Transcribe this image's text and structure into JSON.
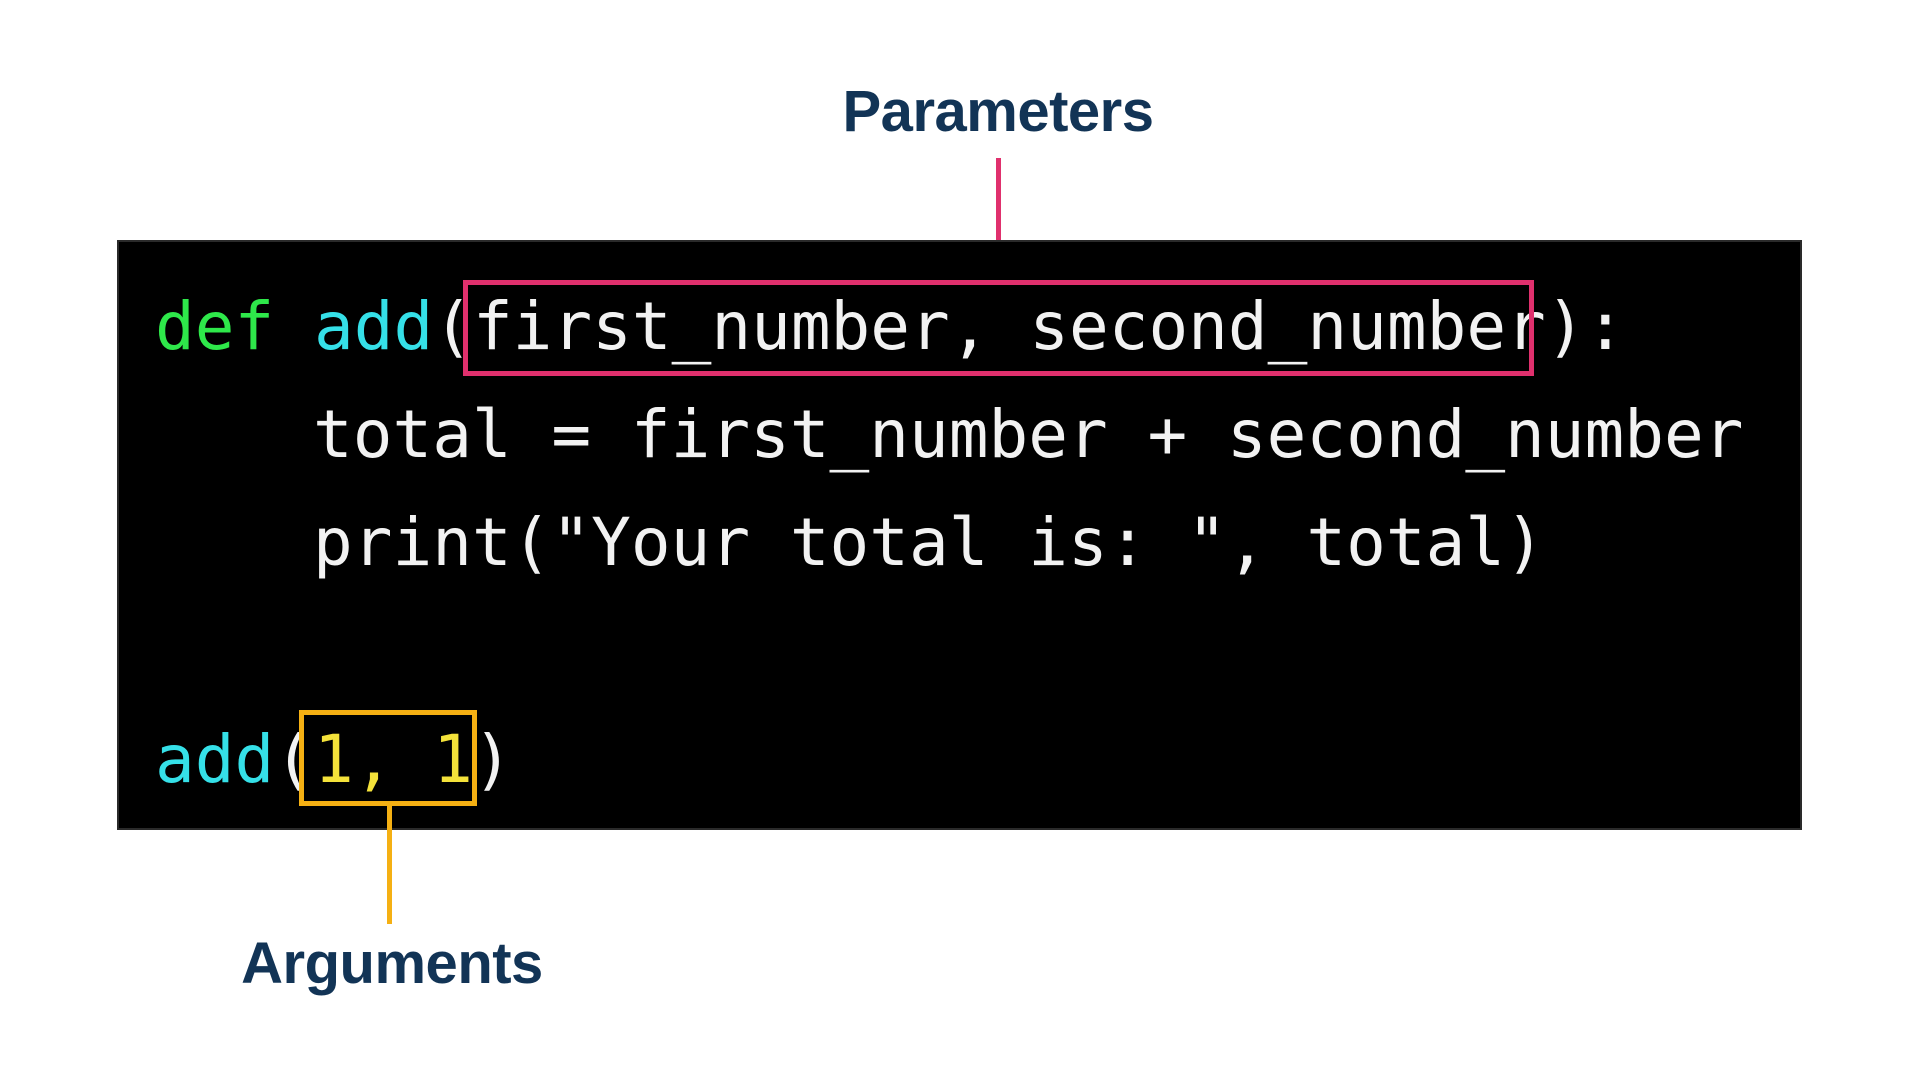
{
  "labels": {
    "parameters": "Parameters",
    "arguments": "Arguments"
  },
  "code": {
    "line1": {
      "keyword": "def",
      "space": " ",
      "func": "add",
      "open": "(",
      "params": "first_number, second_number",
      "close": "):"
    },
    "line2": "total = first_number + second_number",
    "line3": "print(\"Your total is: \", total)",
    "line4": {
      "func": "add",
      "open": "(",
      "args": "1, 1",
      "close": ")"
    }
  },
  "colors": {
    "label_text": "#123456",
    "parameters_highlight": "#e0306d",
    "arguments_highlight": "#f5b013",
    "code_background": "#000000",
    "keyword": "#2ee84a",
    "function_name": "#35e0e8",
    "number": "#f4e23a",
    "code_text": "#f2f2f2"
  }
}
